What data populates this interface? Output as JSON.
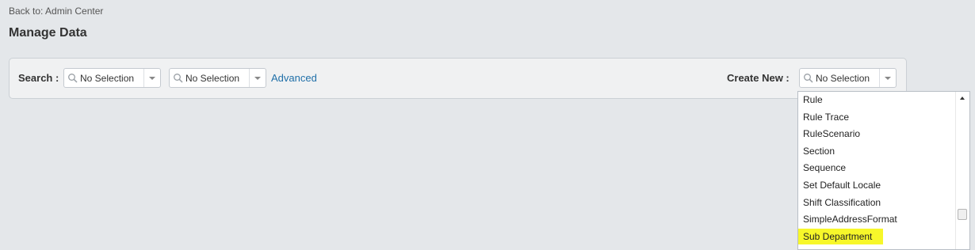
{
  "header": {
    "back_link": "Back to: Admin Center",
    "page_title": "Manage Data"
  },
  "search": {
    "label": "Search :",
    "type_select": {
      "value": "No Selection",
      "icon": "search-icon"
    },
    "item_select": {
      "value": "No Selection",
      "icon": "search-icon"
    },
    "advanced_link": "Advanced"
  },
  "create_new": {
    "label": "Create New :",
    "select": {
      "value": "No Selection",
      "icon": "search-icon",
      "expanded": true
    }
  },
  "dropdown": {
    "options": [
      "Rule",
      "Rule Trace",
      "RuleScenario",
      "Section",
      "Sequence",
      "Set Default Locale",
      "Shift Classification",
      "SimpleAddressFormat",
      "Sub Department"
    ],
    "highlighted": "Sub Department",
    "highlight_color": "#f7f72a"
  },
  "colors": {
    "background": "#e4e7ea",
    "link": "#1f6fa8",
    "panel": "#f0f1f2"
  }
}
